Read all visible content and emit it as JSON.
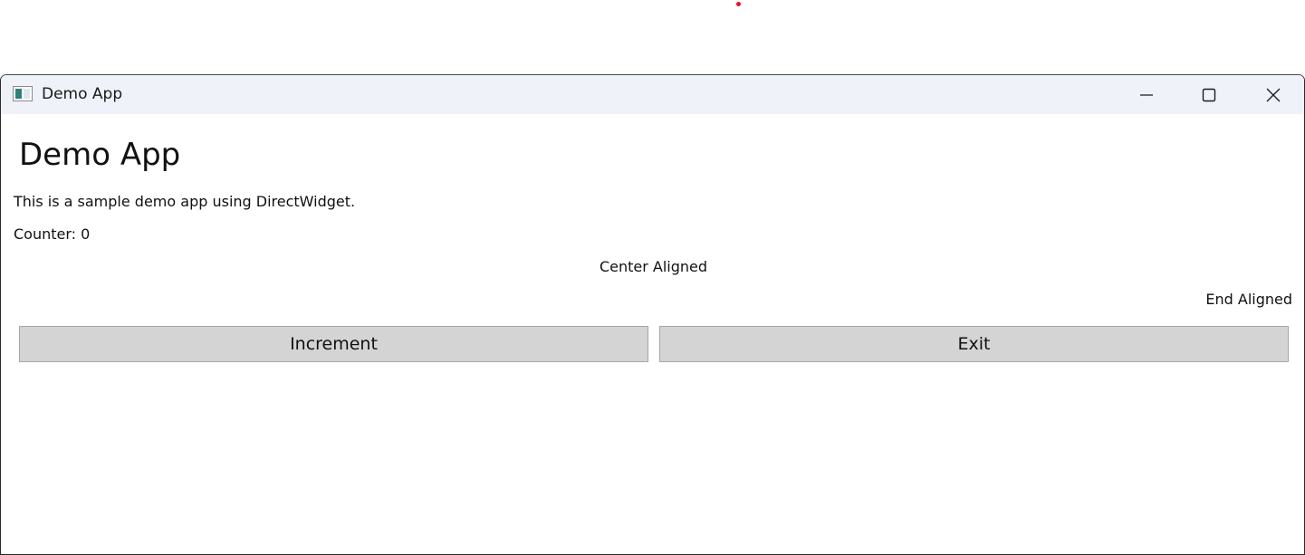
{
  "window": {
    "title": "Demo App",
    "controls": {
      "minimize_icon": "minimize-icon",
      "maximize_icon": "maximize-icon",
      "close_icon": "close-icon"
    }
  },
  "main": {
    "heading": "Demo App",
    "description": "This is a sample demo app using DirectWidget.",
    "counter": "Counter: 0",
    "center_text": "Center Aligned",
    "end_text": "End Aligned",
    "buttons": {
      "increment_label": "Increment",
      "exit_label": "Exit"
    }
  },
  "colors": {
    "titlebar_bg": "#eff2f8",
    "button_bg": "#d4d4d4",
    "cursor_dot": "#e8112d"
  }
}
